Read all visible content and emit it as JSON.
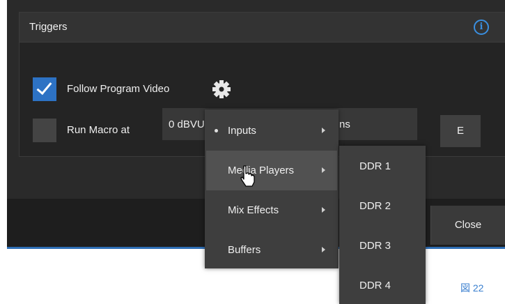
{
  "panel": {
    "title": "Triggers",
    "info_icon": "info-icon"
  },
  "follow_program": {
    "checked": true,
    "label": "Follow Program Video",
    "settings_icon": "gear-icon"
  },
  "run_macro": {
    "checked": false,
    "label": "Run Macro at",
    "field_value": "0 dBVU",
    "field_tail": "ns"
  },
  "edit_button": {
    "label": "E"
  },
  "close_button": {
    "label": "Close"
  },
  "context_menu": {
    "items": [
      {
        "label": "Inputs",
        "selected": true
      },
      {
        "label": "Media Players",
        "hover": true
      },
      {
        "label": "Mix Effects"
      },
      {
        "label": "Buffers"
      }
    ]
  },
  "submenu": {
    "items": [
      {
        "label": "DDR 1"
      },
      {
        "label": "DDR 2"
      },
      {
        "label": "DDR 3"
      },
      {
        "label": "DDR 4"
      }
    ]
  },
  "figure_label": "図 22",
  "colors": {
    "accent": "#2d72c4",
    "info": "#3a8fe0",
    "background": "#2a2a2a",
    "menu": "#3e3e3e"
  }
}
